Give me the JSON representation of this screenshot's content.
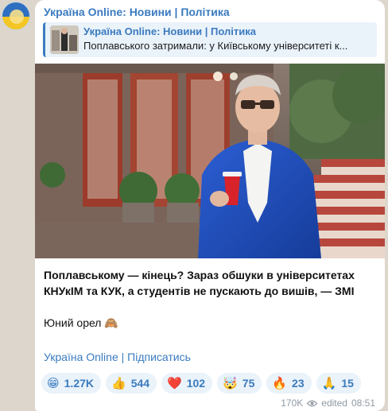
{
  "channel": {
    "name": "Україна Online: Новини | Політика"
  },
  "reply": {
    "title": "Україна Online: Новини | Політика",
    "text": "Поплавського затримали: у Київському університеті к..."
  },
  "post": {
    "headline": "Поплавському — кінець? Зараз обшуки в університетах КНУкІМ та КУК, а студентів не пускають до вишів, — ЗМІ",
    "subtitle": "Юний орел",
    "subtitle_emoji": "🙈",
    "link": "Україна Online | Підписатись"
  },
  "reactions": [
    {
      "emoji": "😁",
      "count": "1.27K",
      "icon": "grin-icon"
    },
    {
      "emoji": "👍",
      "count": "544",
      "icon": "thumbs-up-icon"
    },
    {
      "emoji": "❤️",
      "count": "102",
      "icon": "heart-icon"
    },
    {
      "emoji": "🤯",
      "count": "75",
      "icon": "mind-blown-icon"
    },
    {
      "emoji": "🔥",
      "count": "23",
      "icon": "fire-icon"
    },
    {
      "emoji": "🙏",
      "count": "15",
      "icon": "pray-icon"
    }
  ],
  "meta": {
    "views": "170K",
    "edited": "edited",
    "time": "08:51"
  },
  "colors": {
    "accent": "#3a7bbf",
    "reaction_bg": "#eaf2fa",
    "chat_bg": "#dcd6cc"
  }
}
